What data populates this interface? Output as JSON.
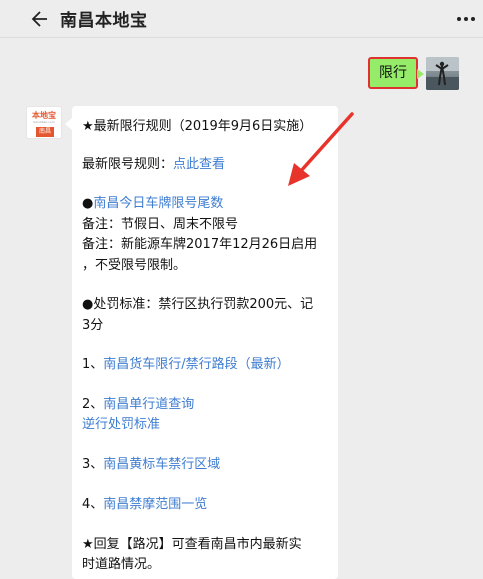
{
  "header": {
    "title": "南昌本地宝"
  },
  "user_message": {
    "text": "限行"
  },
  "bot_avatar": {
    "logo_text": "本地宝",
    "logo_sub": "bendibao.com",
    "logo_city": "南昌"
  },
  "bot_message": {
    "line1": "★最新限行规则（2019年9月6日实施）",
    "line2_prefix": "最新限号规则：",
    "line2_link": "点此查看",
    "line3_prefix": "●",
    "line3_link": "南昌今日车牌限号尾数",
    "line4": "备注：节假日、周末不限号",
    "line5": "备注：新能源车牌2017年12月26日启用",
    "line6": "，不受限号限制。",
    "line7": "●处罚标准：禁行区执行罚款200元、记",
    "line8": "3分",
    "link1_prefix": "1、",
    "link1": "南昌货车限行/禁行路段（最新）",
    "link2_prefix": "2、",
    "link2": "南昌单行道查询",
    "link2b": "逆行处罚标准",
    "link3_prefix": "3、",
    "link3": "南昌黄标车禁行区域",
    "link4_prefix": "4、",
    "link4": "南昌禁摩范围一览",
    "footer1": "★回复【路况】可查看南昌市内最新实",
    "footer2": "时道路情况。"
  },
  "colors": {
    "link": "#3e7dd1",
    "user_bubble": "#95ec69",
    "highlight": "#e03131",
    "brand": "#e4572e"
  },
  "icons": [
    "back-arrow-icon",
    "more-dots-icon",
    "annotation-arrow-icon"
  ]
}
